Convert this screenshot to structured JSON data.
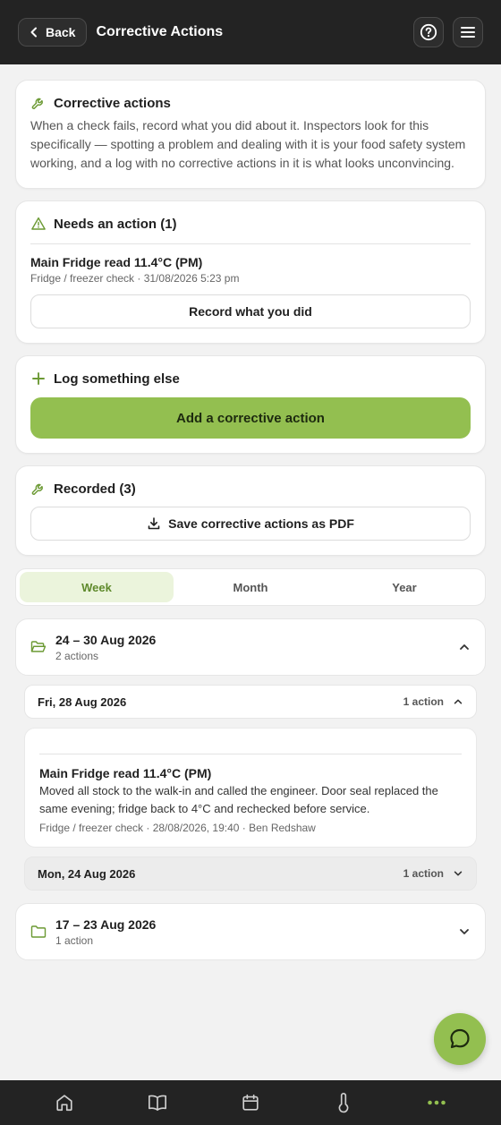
{
  "header": {
    "back_label": "Back",
    "title": "Corrective Actions"
  },
  "intro": {
    "title": "Corrective actions",
    "description": "When a check fails, record what you did about it. Inspectors look for this specifically — spotting a problem and dealing with it is your food safety system working, and a log with no corrective actions in it is what looks unconvincing."
  },
  "needs_action": {
    "title": "Needs an action (1)",
    "item": {
      "title": "Main Fridge read 11.4°C (PM)",
      "meta": "Fridge / freezer check · 31/08/2026 5:23 pm",
      "button_label": "Record what you did"
    }
  },
  "log_else": {
    "title": "Log something else",
    "button_label": "Add a corrective action"
  },
  "recorded": {
    "title": "Recorded (3)",
    "pdf_label": "Save corrective actions as PDF"
  },
  "tabs": [
    {
      "label": "Week",
      "active": true
    },
    {
      "label": "Month",
      "active": false
    },
    {
      "label": "Year",
      "active": false
    }
  ],
  "weeks": [
    {
      "range": "24 – 30 Aug 2026",
      "count": "2 actions",
      "expanded": true,
      "days": [
        {
          "label": "Fri, 28 Aug 2026",
          "count": "1 action",
          "expanded": true,
          "entry": {
            "title": "Main Fridge read 11.4°C (PM)",
            "body": "Moved all stock to the walk-in and called the engineer. Door seal replaced the same evening; fridge back to 4°C and rechecked before service.",
            "meta": "Fridge / freezer check · 28/08/2026, 19:40 · Ben Redshaw"
          }
        },
        {
          "label": "Mon, 24 Aug 2026",
          "count": "1 action",
          "expanded": false
        }
      ]
    },
    {
      "range": "17 – 23 Aug 2026",
      "count": "1 action",
      "expanded": false
    }
  ],
  "bottom_nav": [
    {
      "icon": "home-icon"
    },
    {
      "icon": "book-icon"
    },
    {
      "icon": "calendar-icon"
    },
    {
      "icon": "thermometer-icon"
    },
    {
      "icon": "more-icon",
      "active": true
    }
  ],
  "colors": {
    "accent": "#93bf50",
    "accent_dark": "#5f8a2c",
    "header_bg": "#232323",
    "page_bg": "#f2f2f2"
  }
}
